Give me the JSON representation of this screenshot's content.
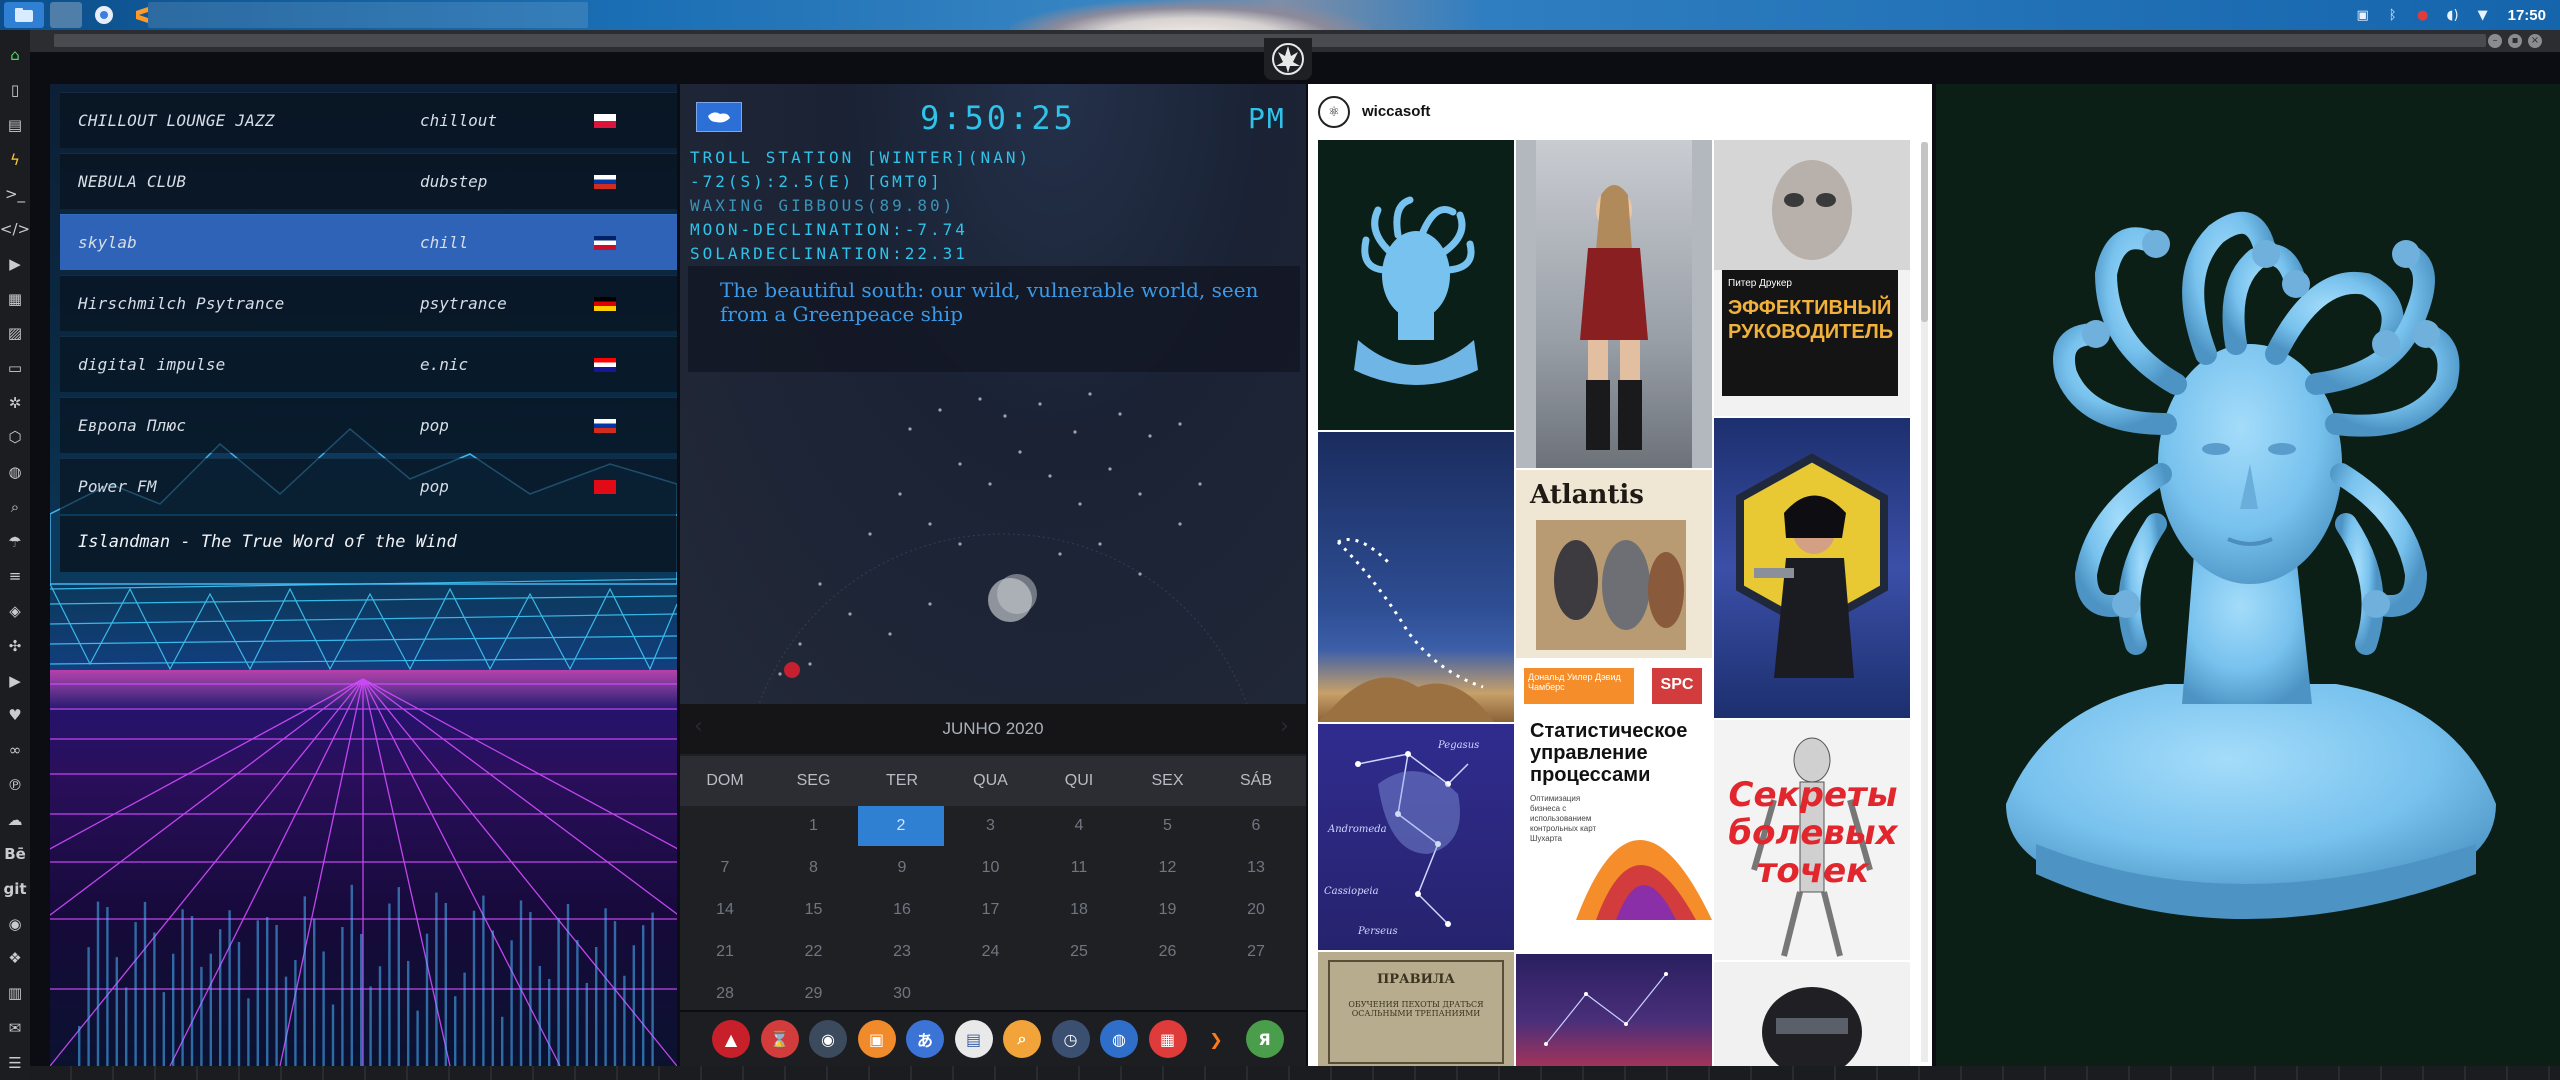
{
  "system": {
    "time": "17:50"
  },
  "radio": {
    "stations": [
      {
        "name": "CHILLOUT LOUNGE JAZZ",
        "genre": "chillout",
        "flag": "pl"
      },
      {
        "name": "NEBULA CLUB",
        "genre": "dubstep",
        "flag": "ru"
      },
      {
        "name": "skylab",
        "genre": "chill",
        "flag": "gb"
      },
      {
        "name": "Hirschmilch Psytrance",
        "genre": "psytrance",
        "flag": "de"
      },
      {
        "name": "digital impulse",
        "genre": "e.nic",
        "flag": "hr"
      },
      {
        "name": "Европа Плюс",
        "genre": "pop",
        "flag": "ru"
      },
      {
        "name": "Power FM",
        "genre": "pop",
        "flag": "tr"
      }
    ],
    "selected_index": 2,
    "now_playing": "Islandman - The True Word of the Wind"
  },
  "station": {
    "time": "9:50:25",
    "ampm": "PM",
    "lines": [
      "TROLL STATION [WINTER](NAN)",
      "-72(S):2.5(E) [GMT0]",
      "WAXING GIBBOUS(89.80)",
      "MOON-DECLINATION:-7.74",
      "SOLARDECLINATION:22.31"
    ],
    "quote": "The beautiful south: our wild, vulnerable world, seen from a Greenpeace ship"
  },
  "calendar": {
    "month": "JUNHO 2020",
    "prev": "‹",
    "next": "›",
    "dows": [
      "DOM",
      "SEG",
      "TER",
      "QUA",
      "QUI",
      "SEX",
      "SÁB"
    ],
    "weeks": [
      [
        "",
        "1",
        "2",
        "3",
        "4",
        "5",
        "6"
      ],
      [
        "7",
        "8",
        "9",
        "10",
        "11",
        "12",
        "13"
      ],
      [
        "14",
        "15",
        "16",
        "17",
        "18",
        "19",
        "20"
      ],
      [
        "21",
        "22",
        "23",
        "24",
        "25",
        "26",
        "27"
      ],
      [
        "28",
        "29",
        "30",
        "",
        "",
        "",
        ""
      ]
    ],
    "today": "2"
  },
  "dock": {
    "apps": [
      {
        "name": "vector-app-icon",
        "color": "#c8202a",
        "glyph": "▲"
      },
      {
        "name": "hourglass-icon",
        "color": "#d23c3c",
        "glyph": "⌛"
      },
      {
        "name": "globe-night-icon",
        "color": "#3b4a5c",
        "glyph": "◉"
      },
      {
        "name": "image-viewer-icon",
        "color": "#f08a2a",
        "glyph": "▣"
      },
      {
        "name": "translate-icon",
        "color": "#3b73d6",
        "glyph": "あ"
      },
      {
        "name": "news-icon",
        "color": "#e9e9e9",
        "glyph": "▤"
      },
      {
        "name": "search-icon",
        "color": "#f2a33a",
        "glyph": "⌕"
      },
      {
        "name": "clock-icon",
        "color": "#3b4f70",
        "glyph": "◷"
      },
      {
        "name": "web-globe-icon",
        "color": "#2f6fc9",
        "glyph": "◍"
      },
      {
        "name": "calendar-icon",
        "color": "#e03b3b",
        "glyph": "▦"
      },
      {
        "name": "arrow-icon",
        "color": "#1d1e22",
        "glyph": "❯"
      },
      {
        "name": "yandex-icon",
        "color": "#4a9d4a",
        "glyph": "Я"
      }
    ]
  },
  "feed": {
    "username": "wiccasoft",
    "books": {
      "drucker_author": "Питер Друкер",
      "drucker_title": "ЭФФЕКТИВНЫЙ РУКОВОДИТЕЛЬ",
      "atlantis_title": "Atlantis",
      "spc_authors": "Дональд Уилер Дэвид Чамберс",
      "spc_badge": "SPC",
      "spc_title": "Статистическое управление процессами",
      "spc_sub": "Оптимизация бизнеса с использованием контрольных карт Шухарта",
      "secrets_title": "Секреты болевых точек",
      "pravila_title": "ПРАВИЛА",
      "pravila_sub": "ОБУЧЕНИЯ ПЕХОТЫ ДРАТЬСЯ ОСАЛЬНЫМИ ТРЕПАНИЯМИ"
    },
    "pegasus_labels": [
      "Pegasus",
      "Andromeda",
      "Cassiopeia",
      "Perseus"
    ]
  }
}
